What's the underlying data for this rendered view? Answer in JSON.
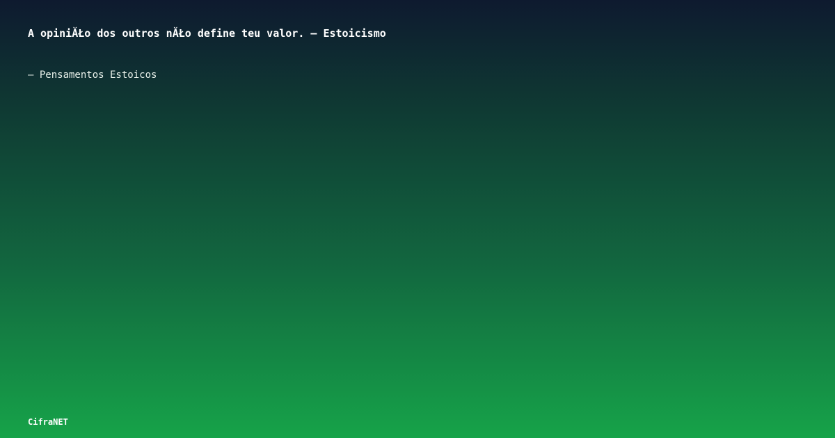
{
  "card": {
    "quote": "A opiniĂŁo dos outros nĂŁo define teu valor. – Estoicismo",
    "source": "– Pensamentos Estoicos",
    "brand": "CifraNET"
  },
  "colors": {
    "gradient_top": "#0e1a2f",
    "gradient_bottom": "#16a349",
    "text": "#ffffff"
  }
}
